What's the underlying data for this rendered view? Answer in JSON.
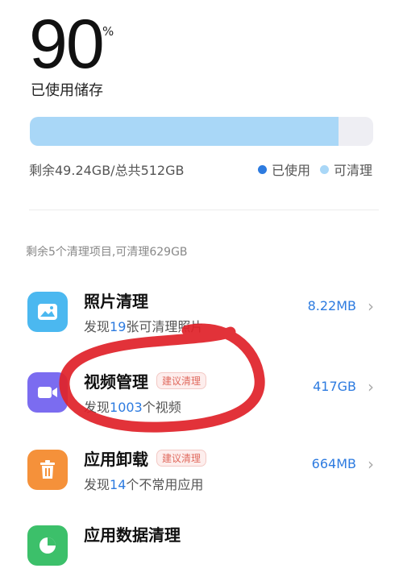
{
  "storage": {
    "percent": "90",
    "percent_sign": "%",
    "used_label": "已使用储存",
    "used_fraction": 0.9,
    "summary": "剩余49.24GB/总共512GB",
    "legend": [
      {
        "label": "已使用",
        "color": "#2d7be0"
      },
      {
        "label": "可清理",
        "color": "#a9d7f7"
      }
    ]
  },
  "section_hint": "剩余5个清理项目,可清理629GB",
  "items": [
    {
      "title": "照片清理",
      "badge": "",
      "sub_prefix": "发现",
      "sub_num": "19",
      "sub_suffix": "张可清理照片",
      "size": "8.22MB",
      "icon": "photo-icon",
      "color": "#4bb8f0"
    },
    {
      "title": "视频管理",
      "badge": "建议清理",
      "sub_prefix": "发现",
      "sub_num": "1003",
      "sub_suffix": "个视频",
      "size": "417GB",
      "icon": "video-icon",
      "color": "#7b6cf0"
    },
    {
      "title": "应用卸载",
      "badge": "建议清理",
      "sub_prefix": "发现",
      "sub_num": "14",
      "sub_suffix": "个不常用应用",
      "size": "664MB",
      "icon": "trash-icon",
      "color": "#f5913a"
    },
    {
      "title": "应用数据清理",
      "badge": "",
      "sub_prefix": "",
      "sub_num": "",
      "sub_suffix": "",
      "size": "",
      "icon": "pie-chart-icon",
      "color": "#3cc06a"
    }
  ]
}
